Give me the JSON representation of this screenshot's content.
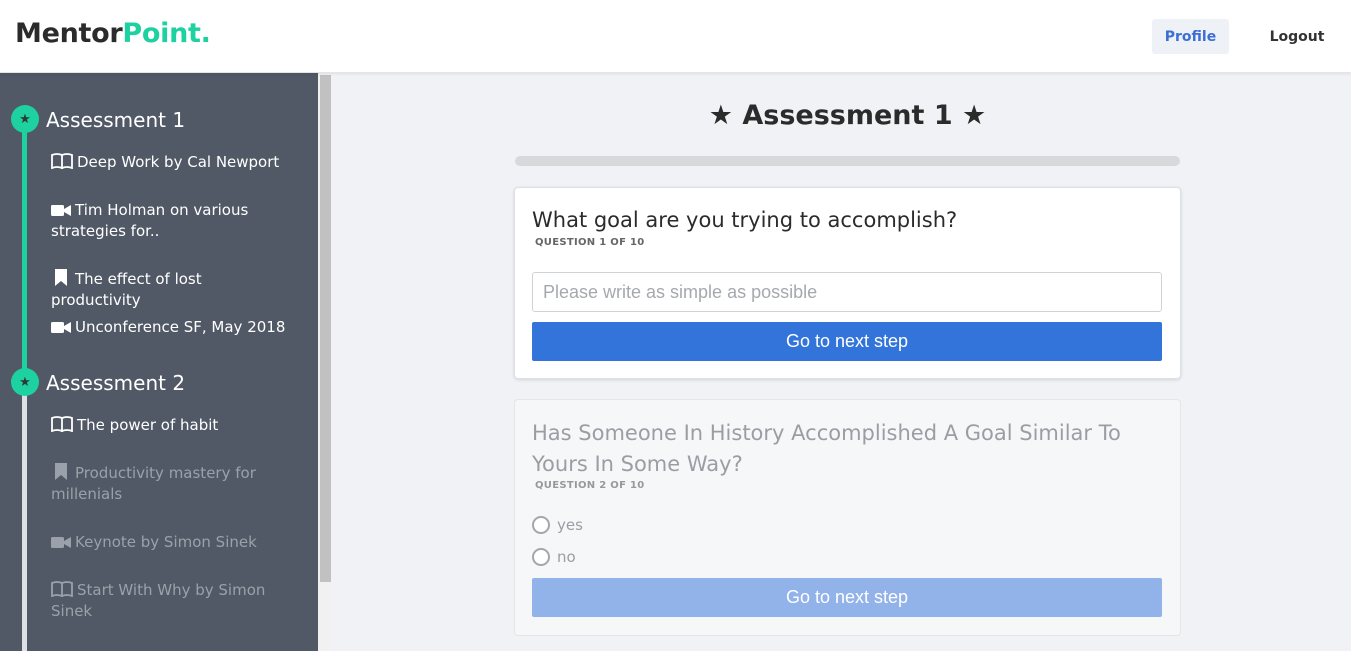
{
  "header": {
    "logo_part1": "Mentor",
    "logo_part2": "Point.",
    "profile_label": "Profile",
    "logout_label": "Logout"
  },
  "sidebar": {
    "sections": [
      {
        "title": "Assessment 1",
        "items": [
          {
            "icon": "book-icon",
            "label": "Deep Work by Cal Newport"
          },
          {
            "icon": "video-icon",
            "label": "Tim Holman on various strategies for.."
          },
          {
            "icon": "bookmark-icon",
            "label": "The effect of lost productivity"
          },
          {
            "icon": "video-icon",
            "label": "Unconference SF, May 2018"
          }
        ]
      },
      {
        "title": "Assessment 2",
        "items": [
          {
            "icon": "book-icon",
            "label": "The power of habit"
          },
          {
            "icon": "bookmark-icon",
            "label": "Productivity mastery for millenials"
          },
          {
            "icon": "video-icon",
            "label": "Keynote by Simon Sinek"
          },
          {
            "icon": "book-icon",
            "label": "Start With Why by Simon Sinek"
          }
        ]
      }
    ]
  },
  "main": {
    "title": "★ Assessment 1 ★",
    "progress_percent": 0,
    "questions": [
      {
        "text": "What goal are you trying to accomplish?",
        "sub": "QUESTION 1 OF 10",
        "input_placeholder": "Please write as simple as possible",
        "input_value": "",
        "button_label": "Go to next step"
      },
      {
        "text": "Has Someone In History Accomplished A Goal Similar To Yours In Some Way?",
        "sub": "QUESTION 2 OF 10",
        "options": [
          "yes",
          "no"
        ],
        "button_label": "Go to next step"
      }
    ]
  },
  "colors": {
    "accent_green": "#1dd1a1",
    "primary_blue": "#3374db",
    "sidebar_bg": "#505965"
  }
}
